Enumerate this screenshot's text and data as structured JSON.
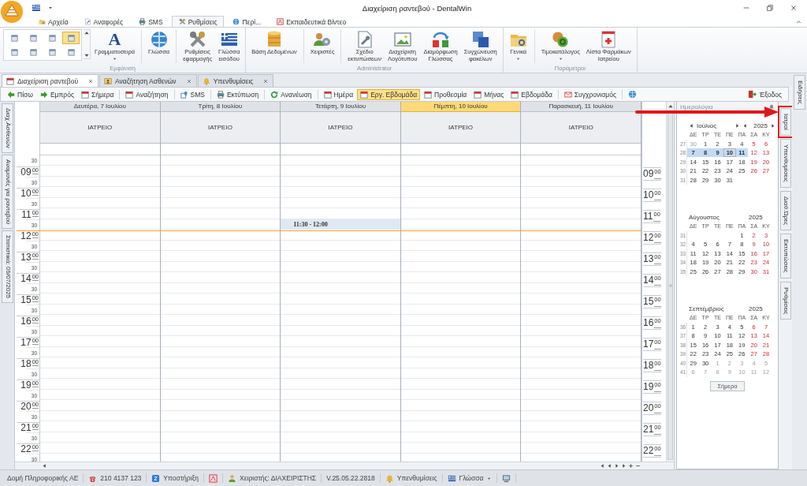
{
  "window": {
    "title": "Διαχείριση ραντεβού - DentalWin"
  },
  "ribbon_tabs": [
    {
      "label": "Αρχεία",
      "selected": false
    },
    {
      "label": "Αναφορές",
      "selected": false
    },
    {
      "label": "SMS",
      "selected": false
    },
    {
      "label": "Ρυθμίσεις",
      "selected": true
    },
    {
      "label": "Περί...",
      "selected": false
    },
    {
      "label": "Εκπαιδευτικά Βίντεο",
      "selected": false
    }
  ],
  "ribbon_groups": [
    {
      "label": "Εμφάνιση",
      "items": [
        {
          "kind": "options",
          "options": [
            {
              "selected": false
            },
            {
              "selected": false
            },
            {
              "selected": false
            },
            {
              "selected": true
            },
            {
              "selected": false
            },
            {
              "selected": false
            },
            {
              "selected": false
            },
            {
              "selected": false
            }
          ]
        },
        {
          "kind": "glyph",
          "glyph": "A",
          "label": "Γραμματοσειρά",
          "caret": true
        },
        {
          "kind": "separator"
        },
        {
          "kind": "button",
          "label": "Γλώσσα",
          "caret": false
        },
        {
          "kind": "separator"
        },
        {
          "kind": "button",
          "label": "Ρυθμίσεις\nεφαρμογής",
          "caret": false
        },
        {
          "kind": "button",
          "label": "Γλώσσα\nεισόδου",
          "caret": false
        }
      ]
    },
    {
      "label": "Administrator",
      "items": [
        {
          "kind": "button",
          "label": "Βάση Δεδομένων",
          "caret": false
        },
        {
          "kind": "separator"
        },
        {
          "kind": "button",
          "label": "Χειριστές",
          "caret": false
        },
        {
          "kind": "separator"
        },
        {
          "kind": "button",
          "label": "Σχέδιο\nεκτυπώσεων",
          "caret": false
        },
        {
          "kind": "button",
          "label": "Διαχείριση\nΛογότυπου",
          "caret": false
        },
        {
          "kind": "button",
          "label": "Διαμόρφωση\nΓλώσσας",
          "caret": false
        },
        {
          "kind": "button",
          "label": "Συγχώνευση\nφακέλων",
          "caret": false
        }
      ]
    },
    {
      "label": "Παράμετροι",
      "items": [
        {
          "kind": "button",
          "label": "Γενικά",
          "caret": true
        },
        {
          "kind": "separator"
        },
        {
          "kind": "button",
          "label": "Τιμοκατάλογος",
          "caret": true
        },
        {
          "kind": "button",
          "label": "Λίστα Φαρμάκων\nΙατρείου",
          "caret": false
        }
      ]
    }
  ],
  "doc_tabs": [
    {
      "label": "Διαχείριση ραντεβού",
      "selected": true
    },
    {
      "label": "Αναζήτηση Ασθενών",
      "selected": false
    },
    {
      "label": "Υπενθυμίσεις",
      "selected": false
    }
  ],
  "toolbar": [
    {
      "kind": "button",
      "label": "Πίσω",
      "selected": false
    },
    {
      "kind": "button",
      "label": "Εμπρός",
      "selected": false
    },
    {
      "kind": "button",
      "label": "Σήμερα",
      "selected": false
    },
    {
      "kind": "separator"
    },
    {
      "kind": "button",
      "label": "Αναζήτηση",
      "selected": false
    },
    {
      "kind": "separator"
    },
    {
      "kind": "button",
      "label": "SMS",
      "selected": false
    },
    {
      "kind": "separator"
    },
    {
      "kind": "button",
      "label": "Εκτύπωση",
      "selected": false
    },
    {
      "kind": "separator"
    },
    {
      "kind": "button",
      "label": "Ανανέωση",
      "selected": false
    },
    {
      "kind": "separator"
    },
    {
      "kind": "button",
      "label": "Ημέρα",
      "selected": false
    },
    {
      "kind": "button",
      "label": "Εργ. Εβδομάδα",
      "selected": true
    },
    {
      "kind": "button",
      "label": "Προθεσμία",
      "selected": false
    },
    {
      "kind": "button",
      "label": "Μήνας",
      "selected": false
    },
    {
      "kind": "button",
      "label": "Εβδομάδα",
      "selected": false
    },
    {
      "kind": "separator"
    },
    {
      "kind": "button",
      "label": "Συγχρονισμός",
      "selected": false
    },
    {
      "kind": "separator"
    },
    {
      "kind": "icon",
      "selected": false
    },
    {
      "kind": "exit",
      "label": "Έξοδος",
      "selected": false
    }
  ],
  "left_tabs": [
    "Διαχ.Ασθενών",
    "Αναμονές για ραντεβού",
    "Στατιστικά: 09/07/2025"
  ],
  "schedule": {
    "days": [
      {
        "title": "Δευτέρα, 7 Ιουλίου",
        "resource": "ΙΑΤΡΕΙΟ",
        "today": false
      },
      {
        "title": "Τρίτη, 8 Ιουλίου",
        "resource": "ΙΑΤΡΕΙΟ",
        "today": false
      },
      {
        "title": "Τετάρτη, 9 Ιουλίου",
        "resource": "ΙΑΤΡΕΙΟ",
        "today": false,
        "appointments": [
          {
            "time": "11:30 - 12:00"
          }
        ]
      },
      {
        "title": "Πέμπτη, 10 Ιουλίου",
        "resource": "ΙΑΤΡΕΙΟ",
        "today": true
      },
      {
        "title": "Παρασκευή, 11 Ιουλίου",
        "resource": "ΙΑΤΡΕΙΟ",
        "today": false
      }
    ],
    "time_scale_left": {
      "top_half": "30",
      "hours": [
        {
          "hour": "09",
          "minutes": "00",
          "half": "30",
          "now": false
        },
        {
          "hour": "10",
          "minutes": "00",
          "half": "30",
          "now": false
        },
        {
          "hour": "11",
          "minutes": "00",
          "half": "30",
          "now": false
        },
        {
          "hour": "12",
          "minutes": "00",
          "half": "30",
          "now": true
        },
        {
          "hour": "13",
          "minutes": "00",
          "half": "30",
          "now": false
        },
        {
          "hour": "14",
          "minutes": "00",
          "half": "30",
          "now": false
        },
        {
          "hour": "15",
          "minutes": "00",
          "half": "30",
          "now": false
        },
        {
          "hour": "16",
          "minutes": "00",
          "half": "30",
          "now": false
        },
        {
          "hour": "17",
          "minutes": "00",
          "half": "30",
          "now": false
        },
        {
          "hour": "18",
          "minutes": "00",
          "half": "30",
          "now": false
        },
        {
          "hour": "19",
          "minutes": "00",
          "half": "30",
          "now": false
        },
        {
          "hour": "20",
          "minutes": "00",
          "half": "30",
          "now": false
        },
        {
          "hour": "21",
          "minutes": "00",
          "half": "30",
          "now": false
        },
        {
          "hour": "22",
          "minutes": "00",
          "half": "30",
          "now": false
        }
      ]
    },
    "time_scale_right": {
      "hours": [
        {
          "hour": "09",
          "minutes": "00"
        },
        {
          "hour": "10",
          "minutes": "00"
        },
        {
          "hour": "11",
          "minutes": "00"
        },
        {
          "hour": "12",
          "minutes": "00"
        },
        {
          "hour": "13",
          "minutes": "00"
        },
        {
          "hour": "14",
          "minutes": "00"
        },
        {
          "hour": "15",
          "minutes": "00"
        },
        {
          "hour": "16",
          "minutes": "00"
        },
        {
          "hour": "17",
          "minutes": "00"
        },
        {
          "hour": "18",
          "minutes": "00"
        },
        {
          "hour": "19",
          "minutes": "00"
        },
        {
          "hour": "20",
          "minutes": "00"
        },
        {
          "hour": "21",
          "minutes": "00"
        },
        {
          "hour": "22",
          "minutes": "00"
        }
      ]
    }
  },
  "calendar": {
    "title": "Ημερολόγια",
    "today_button": "Σήμερα",
    "months": [
      {
        "name": "Ιούλιος",
        "year": "2025",
        "nav": true,
        "weekdays": [
          "ΔΕ",
          "ΤΡ",
          "ΤΕ",
          "ΠΕ",
          "ΠΑ",
          "ΣΑ",
          "ΚΥ"
        ],
        "weeks": [
          {
            "week": "27",
            "days": [
              {
                "day": "30",
                "kind": "other",
                "selected": false
              },
              {
                "day": "1",
                "kind": "day",
                "selected": false
              },
              {
                "day": "2",
                "kind": "day",
                "selected": false
              },
              {
                "day": "3",
                "kind": "day",
                "selected": false
              },
              {
                "day": "4",
                "kind": "day",
                "selected": false
              },
              {
                "day": "5",
                "kind": "day",
                "selected": false
              },
              {
                "day": "6",
                "kind": "day",
                "selected": false
              }
            ]
          },
          {
            "week": "28",
            "days": [
              {
                "day": "7",
                "kind": "day",
                "selected": true
              },
              {
                "day": "8",
                "kind": "day",
                "selected": true
              },
              {
                "day": "9",
                "kind": "day",
                "selected": true
              },
              {
                "day": "10",
                "kind": "today",
                "selected": true
              },
              {
                "day": "11",
                "kind": "day",
                "selected": true
              },
              {
                "day": "12",
                "kind": "day",
                "selected": false
              },
              {
                "day": "13",
                "kind": "day",
                "selected": false
              }
            ]
          },
          {
            "week": "29",
            "days": [
              {
                "day": "14",
                "kind": "day",
                "selected": false
              },
              {
                "day": "15",
                "kind": "day",
                "selected": false
              },
              {
                "day": "16",
                "kind": "day",
                "selected": false
              },
              {
                "day": "17",
                "kind": "day",
                "selected": false
              },
              {
                "day": "18",
                "kind": "day",
                "selected": false
              },
              {
                "day": "19",
                "kind": "day",
                "selected": false
              },
              {
                "day": "20",
                "kind": "day",
                "selected": false
              }
            ]
          },
          {
            "week": "30",
            "days": [
              {
                "day": "21",
                "kind": "day",
                "selected": false
              },
              {
                "day": "22",
                "kind": "day",
                "selected": false
              },
              {
                "day": "23",
                "kind": "day",
                "selected": false
              },
              {
                "day": "24",
                "kind": "day",
                "selected": false
              },
              {
                "day": "25",
                "kind": "day",
                "selected": false
              },
              {
                "day": "26",
                "kind": "day",
                "selected": false
              },
              {
                "day": "27",
                "kind": "day",
                "selected": false
              }
            ]
          },
          {
            "week": "31",
            "days": [
              {
                "day": "28",
                "kind": "day",
                "selected": false
              },
              {
                "day": "29",
                "kind": "day",
                "selected": false
              },
              {
                "day": "30",
                "kind": "day",
                "selected": false
              },
              {
                "day": "31",
                "kind": "day",
                "selected": false
              }
            ]
          }
        ]
      },
      {
        "name": "Αύγουστος",
        "year": "2025",
        "nav": false,
        "weekdays": [
          "ΔΕ",
          "ΤΡ",
          "ΤΕ",
          "ΠΕ",
          "ΠΑ",
          "ΣΑ",
          "ΚΥ"
        ],
        "weeks": [
          {
            "week": "31",
            "days": [
              {
                "kind": "blank"
              },
              {
                "kind": "blank"
              },
              {
                "kind": "blank"
              },
              {
                "kind": "blank"
              },
              {
                "day": "1",
                "kind": "day",
                "selected": false
              },
              {
                "day": "2",
                "kind": "day",
                "selected": false
              },
              {
                "day": "3",
                "kind": "day",
                "selected": false
              }
            ]
          },
          {
            "week": "32",
            "days": [
              {
                "day": "4",
                "kind": "day",
                "selected": false
              },
              {
                "day": "5",
                "kind": "day",
                "selected": false
              },
              {
                "day": "6",
                "kind": "day",
                "selected": false
              },
              {
                "day": "7",
                "kind": "day",
                "selected": false
              },
              {
                "day": "8",
                "kind": "day",
                "selected": false
              },
              {
                "day": "9",
                "kind": "day",
                "selected": false
              },
              {
                "day": "10",
                "kind": "day",
                "selected": false
              }
            ]
          },
          {
            "week": "33",
            "days": [
              {
                "day": "11",
                "kind": "day",
                "selected": false
              },
              {
                "day": "12",
                "kind": "day",
                "selected": false
              },
              {
                "day": "13",
                "kind": "day",
                "selected": false
              },
              {
                "day": "14",
                "kind": "day",
                "selected": false
              },
              {
                "day": "15",
                "kind": "day",
                "selected": false
              },
              {
                "day": "16",
                "kind": "day",
                "selected": false
              },
              {
                "day": "17",
                "kind": "day",
                "selected": false
              }
            ]
          },
          {
            "week": "34",
            "days": [
              {
                "day": "18",
                "kind": "day",
                "selected": false
              },
              {
                "day": "19",
                "kind": "day",
                "selected": false
              },
              {
                "day": "20",
                "kind": "day",
                "selected": false
              },
              {
                "day": "21",
                "kind": "day",
                "selected": false
              },
              {
                "day": "22",
                "kind": "day",
                "selected": false
              },
              {
                "day": "23",
                "kind": "day",
                "selected": false
              },
              {
                "day": "24",
                "kind": "day",
                "selected": false
              }
            ]
          },
          {
            "week": "35",
            "days": [
              {
                "day": "25",
                "kind": "day",
                "selected": false
              },
              {
                "day": "26",
                "kind": "day",
                "selected": false
              },
              {
                "day": "27",
                "kind": "day",
                "selected": false
              },
              {
                "day": "28",
                "kind": "day",
                "selected": false
              },
              {
                "day": "29",
                "kind": "day",
                "selected": false
              },
              {
                "day": "30",
                "kind": "day",
                "selected": false
              },
              {
                "day": "31",
                "kind": "day",
                "selected": false
              }
            ]
          }
        ]
      },
      {
        "name": "Σεπτέμβριος",
        "year": "2025",
        "nav": false,
        "weekdays": [
          "ΔΕ",
          "ΤΡ",
          "ΤΕ",
          "ΠΕ",
          "ΠΑ",
          "ΣΑ",
          "ΚΥ"
        ],
        "weeks": [
          {
            "week": "36",
            "days": [
              {
                "day": "1",
                "kind": "day",
                "selected": false
              },
              {
                "day": "2",
                "kind": "day",
                "selected": false
              },
              {
                "day": "3",
                "kind": "day",
                "selected": false
              },
              {
                "day": "4",
                "kind": "day",
                "selected": false
              },
              {
                "day": "5",
                "kind": "day",
                "selected": false
              },
              {
                "day": "6",
                "kind": "day",
                "selected": false
              },
              {
                "day": "7",
                "kind": "day",
                "selected": false
              }
            ]
          },
          {
            "week": "37",
            "days": [
              {
                "day": "8",
                "kind": "day",
                "selected": false
              },
              {
                "day": "9",
                "kind": "day",
                "selected": false
              },
              {
                "day": "10",
                "kind": "day",
                "selected": false
              },
              {
                "day": "11",
                "kind": "day",
                "selected": false
              },
              {
                "day": "12",
                "kind": "day",
                "selected": false
              },
              {
                "day": "13",
                "kind": "day",
                "selected": false
              },
              {
                "day": "14",
                "kind": "day",
                "selected": false
              }
            ]
          },
          {
            "week": "38",
            "days": [
              {
                "day": "15",
                "kind": "day",
                "selected": false
              },
              {
                "day": "16",
                "kind": "day",
                "selected": false
              },
              {
                "day": "17",
                "kind": "day",
                "selected": false
              },
              {
                "day": "18",
                "kind": "day",
                "selected": false
              },
              {
                "day": "19",
                "kind": "day",
                "selected": false
              },
              {
                "day": "20",
                "kind": "day",
                "selected": false
              },
              {
                "day": "21",
                "kind": "day",
                "selected": false
              }
            ]
          },
          {
            "week": "39",
            "days": [
              {
                "day": "22",
                "kind": "day",
                "selected": false
              },
              {
                "day": "23",
                "kind": "day",
                "selected": false
              },
              {
                "day": "24",
                "kind": "day",
                "selected": false
              },
              {
                "day": "25",
                "kind": "day",
                "selected": false
              },
              {
                "day": "26",
                "kind": "day",
                "selected": false
              },
              {
                "day": "27",
                "kind": "day",
                "selected": false
              },
              {
                "day": "28",
                "kind": "day",
                "selected": false
              }
            ]
          },
          {
            "week": "40",
            "days": [
              {
                "day": "29",
                "kind": "day",
                "selected": false
              },
              {
                "day": "30",
                "kind": "day",
                "selected": false
              },
              {
                "day": "1",
                "kind": "other",
                "selected": false
              },
              {
                "day": "2",
                "kind": "other",
                "selected": false
              },
              {
                "day": "3",
                "kind": "other",
                "selected": false
              },
              {
                "day": "4",
                "kind": "other",
                "selected": false
              },
              {
                "day": "5",
                "kind": "other",
                "selected": false
              }
            ]
          },
          {
            "week": "41",
            "days": [
              {
                "day": "6",
                "kind": "other",
                "selected": false
              },
              {
                "day": "7",
                "kind": "other",
                "selected": false
              },
              {
                "day": "8",
                "kind": "other",
                "selected": false
              },
              {
                "day": "9",
                "kind": "other",
                "selected": false
              },
              {
                "day": "10",
                "kind": "other",
                "selected": false
              },
              {
                "day": "11",
                "kind": "other",
                "selected": false
              },
              {
                "day": "12",
                "kind": "other",
                "selected": false
              }
            ]
          }
        ]
      }
    ]
  },
  "right_tabs": [
    {
      "label": "Ιατροί",
      "outlined": true
    },
    {
      "label": "Υπενθυμίσεις",
      "outlined": false
    },
    {
      "label": "Διαθ.Ώρες",
      "outlined": false
    },
    {
      "label": "Εκτυπώσεις",
      "outlined": false
    },
    {
      "label": "Ρυθμίσεις",
      "outlined": false
    }
  ],
  "news_tab": "Ειδήσεις",
  "status_bar": [
    {
      "kind": "text",
      "label": "Δομή Πληροφορικής ΑΕ"
    },
    {
      "kind": "phone",
      "label": "210 4137 123"
    },
    {
      "kind": "support",
      "label": "Υποστήριξη"
    },
    {
      "kind": "pdf"
    },
    {
      "kind": "user",
      "label": "Χειριστής: ΔΙΑΧΕΙΡΙΣΤΗΣ"
    },
    {
      "kind": "text",
      "label": "V.25.05.22.2818"
    },
    {
      "kind": "bell",
      "label": "Υπενθυμίσεις"
    },
    {
      "kind": "flag",
      "label": "Γλώσσα",
      "caret": true
    },
    {
      "kind": "monitor"
    }
  ]
}
